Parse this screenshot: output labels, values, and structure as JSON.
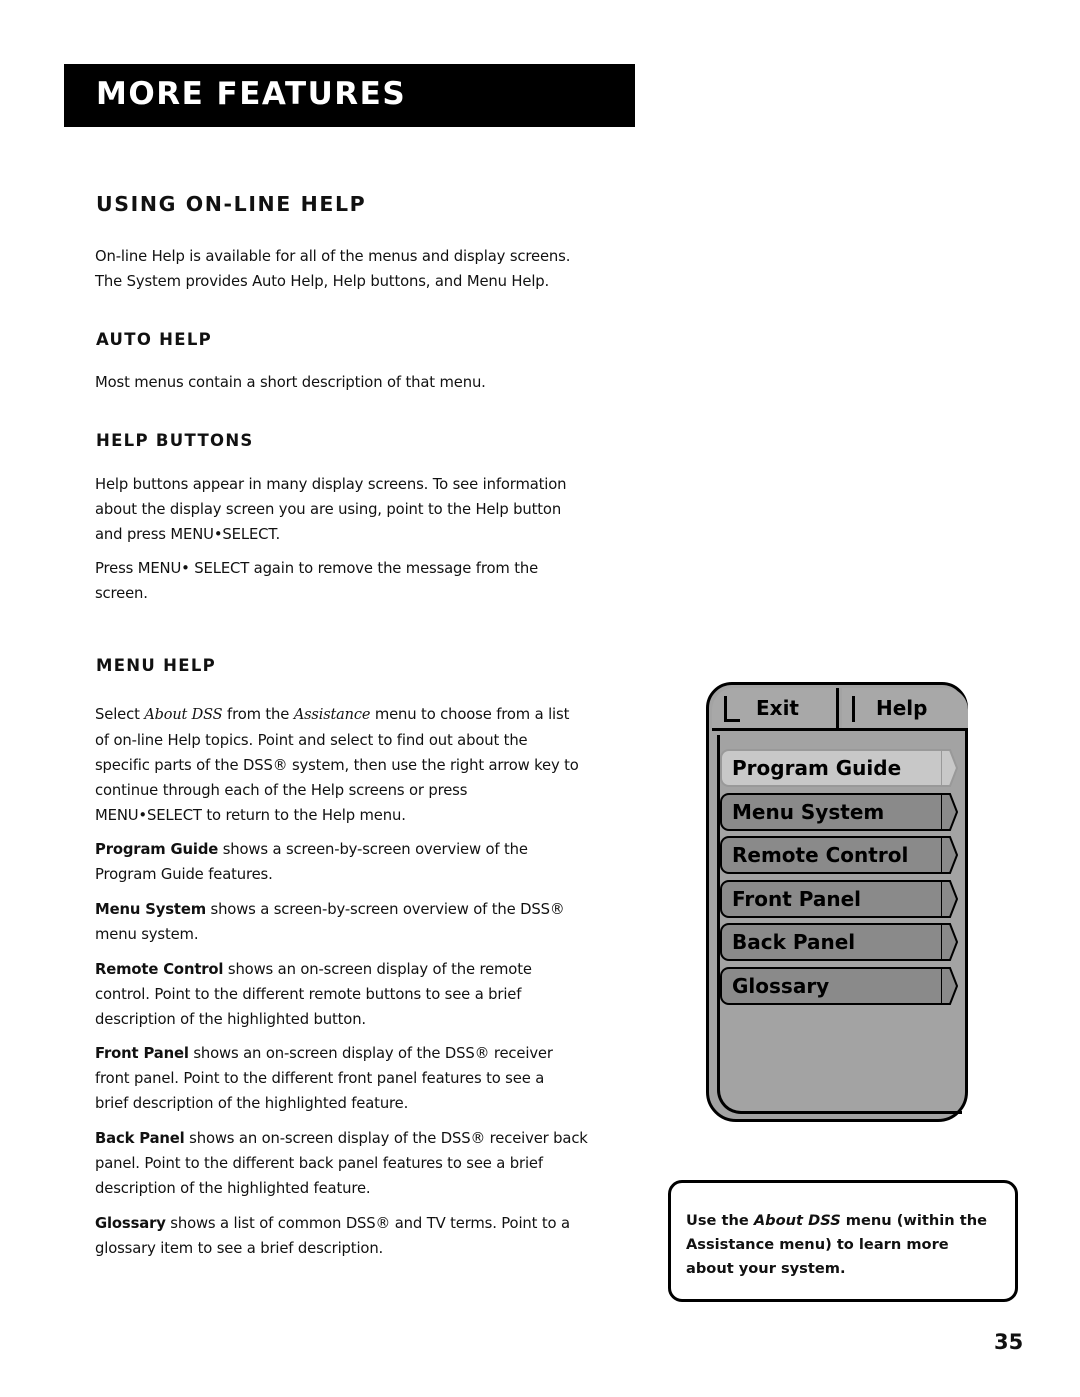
{
  "header": {
    "banner_title": "More Features"
  },
  "section": {
    "title": "Using On-line Help",
    "intro": [
      "On-line Help is available for all of the menus and display screens.",
      "The System provides Auto Help, Help buttons, and Menu Help."
    ]
  },
  "auto_help": {
    "title": "Auto Help",
    "text": "Most menus contain a short description of that menu."
  },
  "help_buttons": {
    "title": "Help Buttons",
    "para1": [
      "Help buttons appear in many display screens. To see information",
      "about the display screen you are using, point to the Help button",
      "and press MENU•SELECT."
    ],
    "para2": [
      "Press MENU• SELECT again to remove the message from the",
      "screen."
    ]
  },
  "menu_help": {
    "title": "Menu Help",
    "intro": {
      "pre": "Select ",
      "about": "About DSS",
      "mid": " from the ",
      "assistance": "Assistance",
      "post": " menu to choose from a list",
      "lines": [
        "of on-line Help topics. Point and select to find out about the",
        "specific parts of the DSS® system, then use the right arrow key to",
        "continue through each of the Help screens or press",
        "MENU•SELECT to return to the Help menu."
      ]
    },
    "topics": [
      {
        "term": "Program Guide",
        "lines": [
          " shows a screen-by-screen overview of the",
          "Program Guide features."
        ]
      },
      {
        "term": "Menu System",
        "lines": [
          "  shows a screen-by-screen overview of the DSS®",
          "menu system."
        ]
      },
      {
        "term": "Remote Control",
        "lines": [
          " shows an on-screen display of the remote",
          "control. Point to the different remote buttons to see a brief",
          "description of the highlighted button."
        ]
      },
      {
        "term": "Front Panel",
        "lines": [
          "  shows an on-screen display of the DSS® receiver",
          "front panel. Point to the different front panel features to see a",
          "brief description of the highlighted feature."
        ]
      },
      {
        "term": "Back Panel",
        "lines": [
          " shows an on-screen display of the DSS® receiver back",
          "panel. Point to the different back panel features to see a brief",
          "description of the highlighted feature."
        ]
      },
      {
        "term": "Glossary",
        "lines": [
          " shows a list of common DSS® and TV terms.  Point to a",
          "glossary item to see a brief description."
        ]
      }
    ]
  },
  "tv_menu": {
    "tabs": [
      "Exit",
      "Help"
    ],
    "items": [
      "Program Guide",
      "Menu System",
      "Remote Control",
      "Front Panel",
      "Back Panel",
      "Glossary"
    ],
    "selected_index": 0,
    "colors": {
      "frame": "#a3a3a3",
      "item": "#8a8a8a",
      "item_selected": "#c8c8c8"
    }
  },
  "note": {
    "pre": "Use the ",
    "italic": "About DSS",
    "post": " menu (within the Assistance menu) to learn more about your system."
  },
  "page_number": "35"
}
